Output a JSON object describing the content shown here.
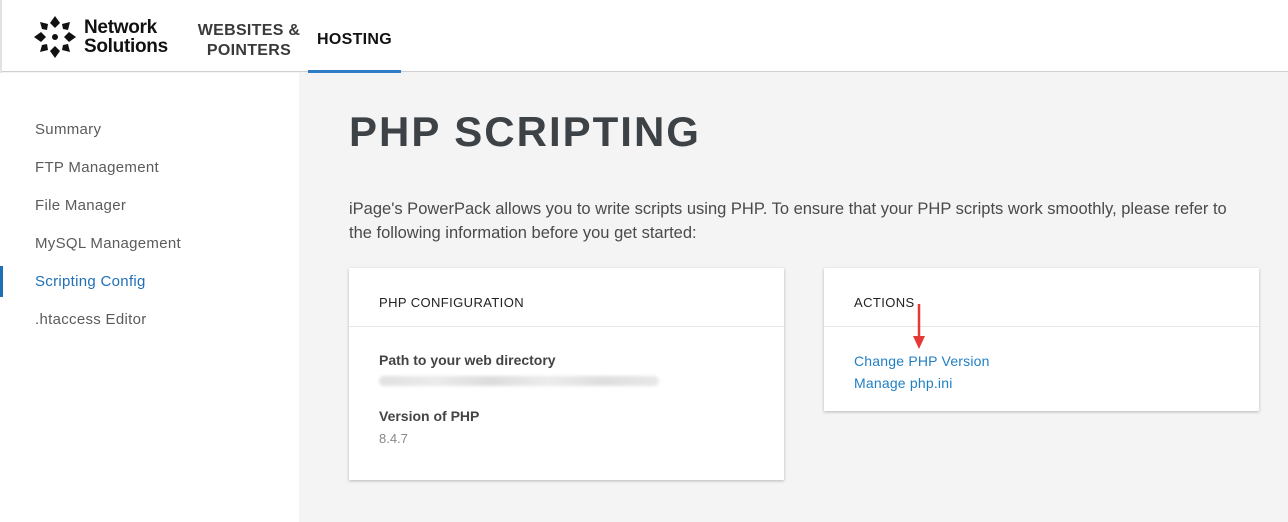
{
  "header": {
    "logo_line1": "Network",
    "logo_line2": "Solutions",
    "nav": {
      "websites_line1": "WEBSITES &",
      "websites_line2": "POINTERS",
      "hosting": "HOSTING"
    }
  },
  "sidebar": {
    "items": [
      {
        "label": "Summary"
      },
      {
        "label": "FTP Management"
      },
      {
        "label": "File Manager"
      },
      {
        "label": "MySQL Management"
      },
      {
        "label": "Scripting Config"
      },
      {
        "label": ".htaccess Editor"
      }
    ],
    "active_index": 4
  },
  "main": {
    "title": "PHP SCRIPTING",
    "intro": "iPage's PowerPack allows you to write scripts using PHP. To ensure that your PHP scripts work smoothly, please refer to the following information before you get started:",
    "config_card": {
      "header": "PHP CONFIGURATION",
      "path_label": "Path to your web directory",
      "version_label": "Version of PHP",
      "version_value": "8.4.7"
    },
    "actions_card": {
      "header": "ACTIONS",
      "links": [
        {
          "label": "Change PHP Version"
        },
        {
          "label": "Manage php.ini"
        }
      ]
    }
  },
  "colors": {
    "accent": "#1f6fb8",
    "link": "#1f7fc4",
    "arrow": "#e53935"
  }
}
